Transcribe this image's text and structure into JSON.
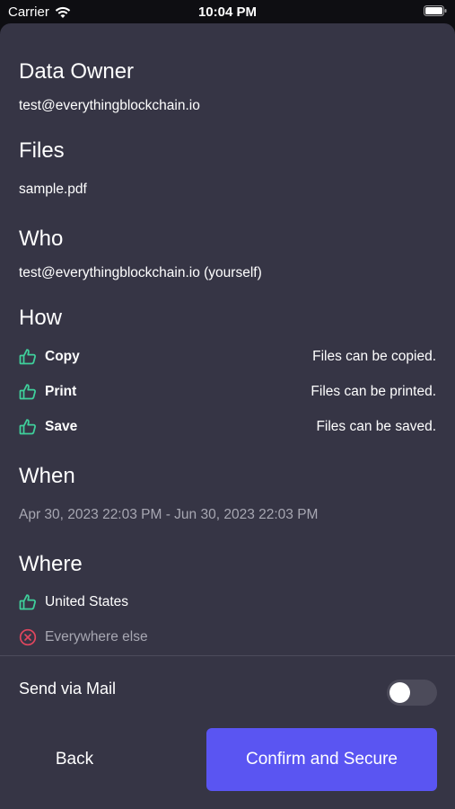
{
  "status_bar": {
    "carrier": "Carrier",
    "time": "10:04 PM",
    "wifi_icon": "wifi-icon",
    "battery_icon": "battery-icon"
  },
  "sections": {
    "data_owner": {
      "title": "Data Owner",
      "value": "test@everythingblockchain.io"
    },
    "files": {
      "title": "Files",
      "value": "sample.pdf"
    },
    "who": {
      "title": "Who",
      "value": "test@everythingblockchain.io (yourself)"
    },
    "how": {
      "title": "How",
      "items": [
        {
          "label": "Copy",
          "desc": "Files can be copied.",
          "icon": "thumbs-up-icon"
        },
        {
          "label": "Print",
          "desc": "Files can be printed.",
          "icon": "thumbs-up-icon"
        },
        {
          "label": "Save",
          "desc": "Files can be saved.",
          "icon": "thumbs-up-icon"
        }
      ]
    },
    "when": {
      "title": "When",
      "value": "Apr 30, 2023 22:03 PM - Jun 30, 2023 22:03 PM"
    },
    "where": {
      "title": "Where",
      "items": [
        {
          "label": "United States",
          "icon": "thumbs-up-icon",
          "allowed": true
        },
        {
          "label": "Everywhere else",
          "icon": "x-circle-icon",
          "allowed": false
        }
      ]
    }
  },
  "send_via_mail": {
    "label": "Send via Mail",
    "enabled": false
  },
  "buttons": {
    "back": "Back",
    "confirm": "Confirm and Secure"
  },
  "colors": {
    "sheet_bg": "#363545",
    "accent_green": "#3fcf9b",
    "deny_red": "#e0465e",
    "primary_button": "#5a55f2"
  }
}
